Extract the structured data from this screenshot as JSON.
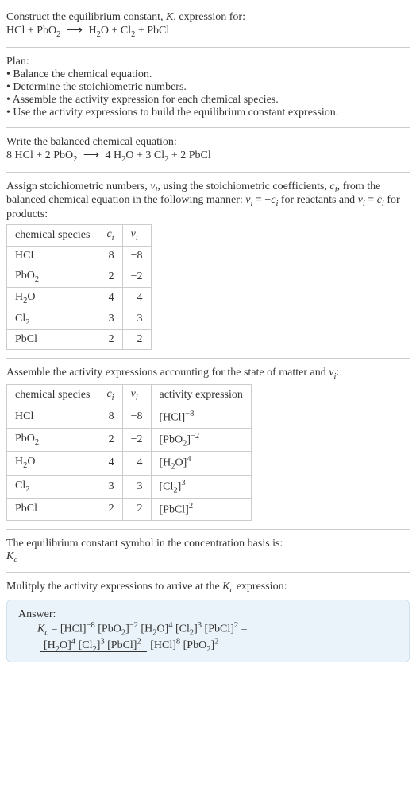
{
  "intro": {
    "line1": "Construct the equilibrium constant, ",
    "k": "K",
    "line1b": ", expression for:",
    "eq_lhs1": "HCl + PbO",
    "eq_lhs1_sub": "2",
    "arrow": "⟶",
    "eq_rhs1": "H",
    "eq_rhs1_sub": "2",
    "eq_rhs2": "O + Cl",
    "eq_rhs2_sub": "2",
    "eq_rhs3": " + PbCl"
  },
  "plan": {
    "title": "Plan:",
    "b1": "• Balance the chemical equation.",
    "b2": "• Determine the stoichiometric numbers.",
    "b3": "• Assemble the activity expression for each chemical species.",
    "b4": "• Use the activity expressions to build the equilibrium constant expression."
  },
  "balanced": {
    "title": "Write the balanced chemical equation:",
    "l1": "8 HCl + 2 PbO",
    "l1s": "2",
    "arrow": "⟶",
    "r1": "4 H",
    "r1s": "2",
    "r2": "O + 3 Cl",
    "r2s": "2",
    "r3": " + 2 PbCl"
  },
  "assign": {
    "p1": "Assign stoichiometric numbers, ",
    "nu": "ν",
    "i": "i",
    "p2": ", using the stoichiometric coefficients, ",
    "c": "c",
    "p3": ", from the balanced chemical equation in the following manner: ",
    "eq1a": "ν",
    "eq1b": " = −",
    "eq1c": "c",
    "p4": " for reactants and ",
    "eq2a": "ν",
    "eq2b": " = ",
    "eq2c": "c",
    "p5": " for products:"
  },
  "table1": {
    "h1": "chemical species",
    "h2": "c",
    "h3": "ν",
    "hi": "i",
    "rows": [
      {
        "sp": "HCl",
        "spsub": "",
        "c": "8",
        "v": "−8"
      },
      {
        "sp": "PbO",
        "spsub": "2",
        "c": "2",
        "v": "−2"
      },
      {
        "sp": "H",
        "spsub": "2",
        "sp2": "O",
        "c": "4",
        "v": "4"
      },
      {
        "sp": "Cl",
        "spsub": "2",
        "c": "3",
        "v": "3"
      },
      {
        "sp": "PbCl",
        "spsub": "",
        "c": "2",
        "v": "2"
      }
    ]
  },
  "assemble": {
    "p1": "Assemble the activity expressions accounting for the state of matter and ",
    "nu": "ν",
    "i": "i",
    "p2": ":"
  },
  "table2": {
    "h1": "chemical species",
    "h2": "c",
    "h3": "ν",
    "h4": "activity expression",
    "hi": "i",
    "rows": [
      {
        "sp": "HCl",
        "spsub": "",
        "c": "8",
        "v": "−8",
        "ex": "[HCl]",
        "exsup": "−8",
        "exsub": ""
      },
      {
        "sp": "PbO",
        "spsub": "2",
        "c": "2",
        "v": "−2",
        "ex": "[PbO",
        "exsub": "2",
        "ex2": "]",
        "exsup": "−2"
      },
      {
        "sp": "H",
        "spsub": "2",
        "sp2": "O",
        "c": "4",
        "v": "4",
        "ex": "[H",
        "exsub": "2",
        "ex2": "O]",
        "exsup": "4"
      },
      {
        "sp": "Cl",
        "spsub": "2",
        "c": "3",
        "v": "3",
        "ex": "[Cl",
        "exsub": "2",
        "ex2": "]",
        "exsup": "3"
      },
      {
        "sp": "PbCl",
        "spsub": "",
        "c": "2",
        "v": "2",
        "ex": "[PbCl]",
        "exsup": "2",
        "exsub": ""
      }
    ]
  },
  "symbol": {
    "p1": "The equilibrium constant symbol in the concentration basis is:",
    "k": "K",
    "c": "c"
  },
  "final": {
    "p1": "Mulitply the activity expressions to arrive at the ",
    "k": "K",
    "c": "c",
    "p2": " expression:"
  },
  "answer": {
    "label": "Answer:",
    "kc_k": "K",
    "kc_c": "c",
    "eq": " = [HCl]",
    "e1": "−8",
    "t2": " [PbO",
    "s2": "2",
    "t2b": "]",
    "e2": "−2",
    "t3": " [H",
    "s3": "2",
    "t3b": "O]",
    "e3": "4",
    "t4": " [Cl",
    "s4": "2",
    "t4b": "]",
    "e4": "3",
    "t5": " [PbCl]",
    "e5": "2",
    "eq2": " = ",
    "num1": "[H",
    "num1s": "2",
    "num1b": "O]",
    "num1e": "4",
    "num2": " [Cl",
    "num2s": "2",
    "num2b": "]",
    "num2e": "3",
    "num3": " [PbCl]",
    "num3e": "2",
    "den1": "[HCl]",
    "den1e": "8",
    "den2": " [PbO",
    "den2s": "2",
    "den2b": "]",
    "den2e": "2"
  }
}
